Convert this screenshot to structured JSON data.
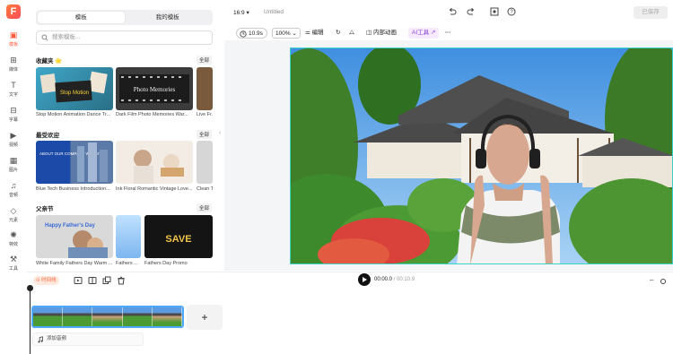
{
  "app": {
    "logo": "F"
  },
  "rail": [
    {
      "label": "模板",
      "icon": "template-icon",
      "active": true
    },
    {
      "label": "媒体",
      "icon": "media-icon"
    },
    {
      "label": "文字",
      "icon": "text-icon"
    },
    {
      "label": "字幕",
      "icon": "subtitle-icon"
    },
    {
      "label": "视频",
      "icon": "video-icon"
    },
    {
      "label": "图片",
      "icon": "image-icon"
    },
    {
      "label": "音频",
      "icon": "audio-icon"
    },
    {
      "label": "元素",
      "icon": "elements-icon"
    },
    {
      "label": "特效",
      "icon": "effects-icon"
    },
    {
      "label": "工具",
      "icon": "tools-icon"
    }
  ],
  "panel": {
    "tabs": [
      "模板",
      "我的模板"
    ],
    "search_placeholder": "搜索模板...",
    "all_label": "全部",
    "sections": [
      {
        "title": "收藏夹 🌟",
        "items": [
          "Stop Motion Animation Dance Tr...",
          "Dark Film Photo Memories War...",
          "Live Fr..."
        ]
      },
      {
        "title": "最受欢迎",
        "items": [
          "Blue Tech Business Introduction...",
          "Ink Floral Romantic Vintage Love...",
          "Clean T..."
        ]
      },
      {
        "title": "父亲节",
        "items": [
          "White Family Fathers Day Warm ...",
          "Fathers ...",
          "Fathers Day Promo"
        ]
      }
    ],
    "thumb_text": {
      "sm": "Stop Motion",
      "pm": "Photo Memories",
      "tech": "ABOUT OUR COMPANY WEBSITE",
      "happy": "Happy Father's Day",
      "save": "SAVE"
    }
  },
  "topbar": {
    "ratio": "16:9",
    "title": "Untitled",
    "save": "已保存"
  },
  "toolbar": {
    "duration": "10.9s",
    "zoom": "100%",
    "edit": "编辑",
    "animation": "内部动画",
    "ai": "AI工具"
  },
  "timeline": {
    "chip": "时间线",
    "current": "00:00.0",
    "total": "/ 00:10.9",
    "add": "+",
    "add_audio": "添加音频"
  },
  "colors": {
    "accent": "#ff5a3c",
    "canvas_border": "#40d0c8",
    "clip_border": "#4fa8ff"
  }
}
